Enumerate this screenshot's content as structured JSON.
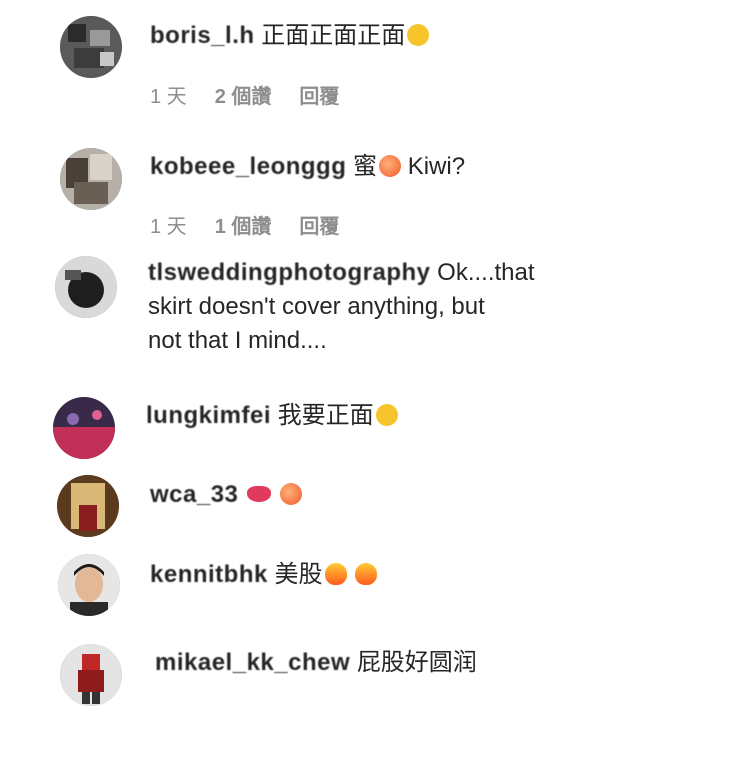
{
  "comments": [
    {
      "username": "boris_l.h",
      "text": "正面正面正面",
      "emoji": [
        "face-with-tears-of-joy-icon"
      ],
      "time": "1 天",
      "likes": "2 個讚",
      "reply": "回覆"
    },
    {
      "username": "kobeee_leonggg",
      "text_before": "蜜",
      "text_after": "Kiwi?",
      "emoji": [
        "peach-icon"
      ],
      "time": "1 天",
      "likes": "1 個讚",
      "reply": "回覆"
    },
    {
      "username": "tlsweddingphotography",
      "text": "Ok....that",
      "line2": "skirt doesn't cover anything, but",
      "line3": "not that I mind...."
    },
    {
      "username": "lungkimfei",
      "text": "我要正面",
      "emoji": [
        "crying-face-icon"
      ]
    },
    {
      "username": "wca_33",
      "emoji": [
        "kiss-mark-icon",
        "peach-icon"
      ]
    },
    {
      "username": "kennitbhk",
      "text": "美股",
      "emoji": [
        "fire-icon",
        "fire-icon"
      ]
    },
    {
      "username": "mikael_kk_chew",
      "text": "屁股好圆润"
    }
  ],
  "colors": {
    "text": "#262626",
    "meta": "#8e8e8e",
    "background": "#ffffff"
  }
}
